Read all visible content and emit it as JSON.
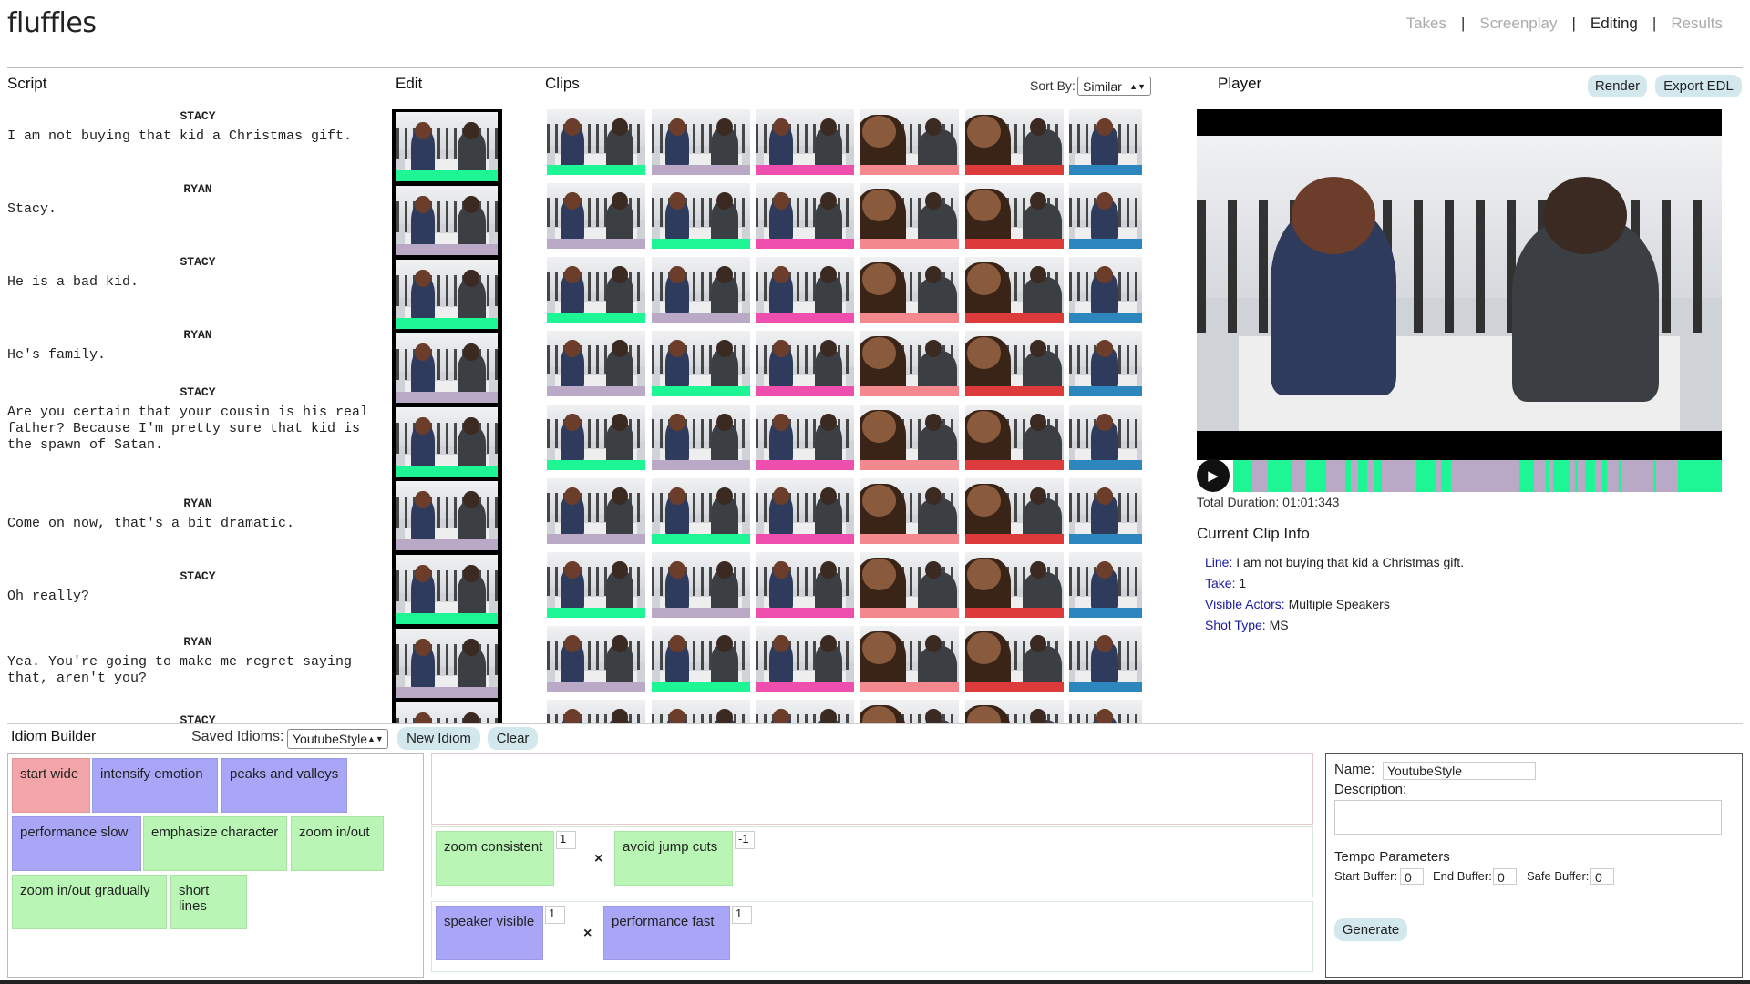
{
  "brand": "fluffles",
  "nav": [
    {
      "label": "Takes",
      "active": false
    },
    {
      "label": "Screenplay",
      "active": false
    },
    {
      "label": "Editing",
      "active": true
    },
    {
      "label": "Results",
      "active": false
    }
  ],
  "nav_separator": "|",
  "sections": {
    "script": "Script",
    "edit": "Edit",
    "clips": "Clips",
    "player": "Player"
  },
  "sort": {
    "label": "Sort By:",
    "value": "Similar"
  },
  "buttons": {
    "render": "Render",
    "export": "Export EDL"
  },
  "script": [
    {
      "speaker": "STACY",
      "line": "I am not buying that kid a Christmas gift."
    },
    {
      "speaker": "RYAN",
      "line": "Stacy."
    },
    {
      "speaker": "STACY",
      "line": "He is a bad kid."
    },
    {
      "speaker": "RYAN",
      "line": "He's family."
    },
    {
      "speaker": "STACY",
      "line": "Are you certain that your cousin is his real\nfather? Because I'm pretty sure that kid is\nthe spawn of Satan."
    },
    {
      "speaker": "RYAN",
      "line": "Come on now, that's a bit dramatic."
    },
    {
      "speaker": "STACY",
      "line": "Oh really?"
    },
    {
      "speaker": "RYAN",
      "line": "Yea. You're going to make me regret saying\nthat, aren't you?"
    },
    {
      "speaker": "STACY",
      "line": ""
    }
  ],
  "colors": {
    "green": "#1ef595",
    "lavender": "#b9a9c7",
    "pink": "#ee4fae",
    "salmon": "#f3898f",
    "red": "#dd3b3b",
    "blue": "#2e86bf"
  },
  "edit_strip_bars": [
    "green",
    "lavender",
    "green",
    "lavender",
    "green",
    "lavender",
    "green",
    "lavender",
    "green"
  ],
  "clip_columns": [
    {
      "bar": "green",
      "shot": "wide"
    },
    {
      "bar": "lavender",
      "shot": "wide"
    },
    {
      "bar": "pink",
      "shot": "wide"
    },
    {
      "bar": "salmon",
      "shot": "close"
    },
    {
      "bar": "red",
      "shot": "close"
    },
    {
      "bar": "blue",
      "shot": "single"
    }
  ],
  "clip_row_overrides": [
    {
      "row": 1,
      "col": 0,
      "bar": "lavender"
    },
    {
      "row": 1,
      "col": 1,
      "bar": "green"
    },
    {
      "row": 2,
      "col": 0,
      "bar": "green"
    },
    {
      "row": 2,
      "col": 1,
      "bar": "lavender"
    },
    {
      "row": 3,
      "col": 0,
      "bar": "lavender"
    },
    {
      "row": 3,
      "col": 1,
      "bar": "green"
    },
    {
      "row": 4,
      "col": 0,
      "bar": "green"
    },
    {
      "row": 4,
      "col": 1,
      "bar": "lavender"
    },
    {
      "row": 5,
      "col": 0,
      "bar": "lavender"
    },
    {
      "row": 5,
      "col": 1,
      "bar": "green"
    },
    {
      "row": 6,
      "col": 0,
      "bar": "green"
    },
    {
      "row": 6,
      "col": 1,
      "bar": "lavender"
    },
    {
      "row": 7,
      "col": 0,
      "bar": "lavender"
    },
    {
      "row": 7,
      "col": 1,
      "bar": "green"
    }
  ],
  "timeline_green_segments": [
    [
      0.0,
      0.04
    ],
    [
      0.07,
      0.12
    ],
    [
      0.15,
      0.19
    ],
    [
      0.23,
      0.24
    ],
    [
      0.255,
      0.275
    ],
    [
      0.29,
      0.305
    ],
    [
      0.375,
      0.415
    ],
    [
      0.425,
      0.445
    ],
    [
      0.585,
      0.615
    ],
    [
      0.64,
      0.645
    ],
    [
      0.655,
      0.69
    ],
    [
      0.7,
      0.705
    ],
    [
      0.72,
      0.74
    ],
    [
      0.755,
      0.765
    ],
    [
      0.79,
      0.79
    ],
    [
      0.86,
      0.86
    ],
    [
      0.91,
      1.0
    ]
  ],
  "player": {
    "total_duration": "Total Duration: 01:01:343"
  },
  "clip_info": {
    "title": "Current Clip Info",
    "fields": [
      {
        "key": "Line:",
        "value": "I am not buying that kid a Christmas gift."
      },
      {
        "key": "Take:",
        "value": "1"
      },
      {
        "key": "Visible Actors:",
        "value": "Multiple Speakers"
      },
      {
        "key": "Shot Type:",
        "value": "MS"
      }
    ]
  },
  "idiom_builder": {
    "title": "Idiom Builder",
    "saved_label": "Saved Idioms:",
    "saved_value": "YoutubeStyle",
    "new_button": "New Idiom",
    "clear_button": "Clear",
    "chips": [
      {
        "label": "start wide",
        "color": "red"
      },
      {
        "label": "intensify emotion",
        "color": "purple"
      },
      {
        "label": "peaks and valleys",
        "color": "purple"
      },
      {
        "label": "performance slow",
        "color": "purple"
      },
      {
        "label": "emphasize character",
        "color": "green"
      },
      {
        "label": "zoom in/out",
        "color": "green"
      },
      {
        "label": "zoom in/out gradually",
        "color": "green"
      },
      {
        "label": "short lines",
        "color": "green"
      }
    ],
    "rules": [
      {
        "a": {
          "label": "zoom consistent",
          "color": "green",
          "weight": "1"
        },
        "b": {
          "label": "avoid jump cuts",
          "color": "green",
          "weight": "-1"
        }
      },
      {
        "a": {
          "label": "speaker visible",
          "color": "purple",
          "weight": "1"
        },
        "b": {
          "label": "performance fast",
          "color": "purple",
          "weight": "1"
        }
      }
    ],
    "times_symbol": "×",
    "form": {
      "name_label": "Name:",
      "name_value": "YoutubeStyle",
      "description_label": "Description:",
      "description_value": "",
      "tempo_title": "Tempo Parameters",
      "start_label": "Start Buffer:",
      "start_value": "0",
      "end_label": "End Buffer:",
      "end_value": "0",
      "safe_label": "Safe Buffer:",
      "safe_value": "0",
      "generate": "Generate"
    }
  }
}
